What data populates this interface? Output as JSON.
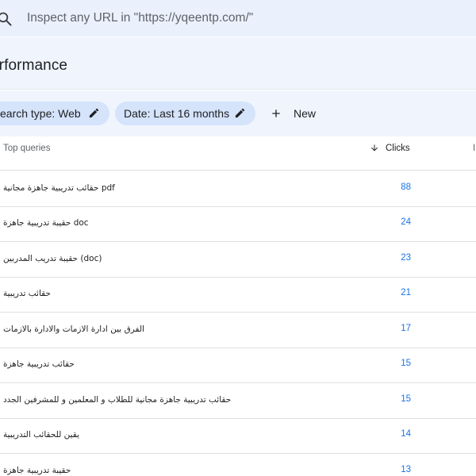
{
  "search": {
    "placeholder": "Inspect any URL in \"https://yqeentp.com/\""
  },
  "page": {
    "title": "erformance"
  },
  "filters": {
    "search_type_label": "earch type: Web",
    "date_label": "Date: Last 16 months",
    "new_label": "New"
  },
  "table": {
    "columns": {
      "queries": "Top queries",
      "clicks": "Clicks",
      "impressions_partial": "I"
    },
    "rows": [
      {
        "query": "حقائب تدريبية جاهزة مجانية pdf",
        "clicks": "88"
      },
      {
        "query": "حقيبة تدريبية جاهزة doc",
        "clicks": "24"
      },
      {
        "query": "حقيبة تدريب المدربين (doc)",
        "clicks": "23"
      },
      {
        "query": "حقائب تدريبية",
        "clicks": "21"
      },
      {
        "query": "الفرق بين ادارة الازمات والادارة بالازمات",
        "clicks": "17"
      },
      {
        "query": "حقائب تدريبية جاهزة",
        "clicks": "15"
      },
      {
        "query": "حقائب تدريبية جاهزة مجانية للطلاب و المعلمين و للمشرفين الجدد",
        "clicks": "15"
      },
      {
        "query": "يقين للحقائب التدريبية",
        "clicks": "14"
      },
      {
        "query": "حقيبة تدريبية جاهزة",
        "clicks": "13"
      }
    ]
  },
  "colors": {
    "accent": "#1a73e8",
    "chip_bg": "#d5e3fb",
    "header_bg": "#f0f5fd",
    "search_bg": "#eaf1fd"
  },
  "icons": {
    "search": "search-icon",
    "pencil": "pencil-icon",
    "plus": "plus-icon",
    "sort": "arrow-down-icon"
  }
}
